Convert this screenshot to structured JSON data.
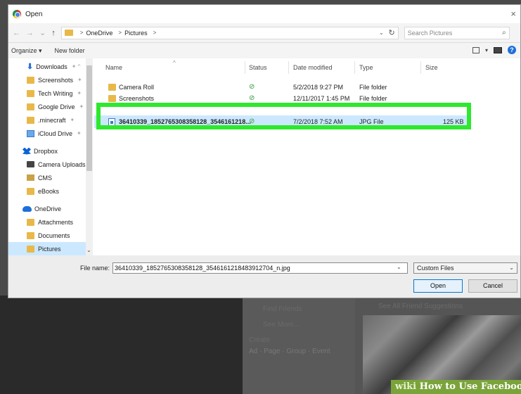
{
  "dialog": {
    "title": "Open",
    "close": "×"
  },
  "nav": {
    "back": "←",
    "forward": "→",
    "history": "⌄",
    "up": "↑",
    "crumbs": [
      "OneDrive",
      "Pictures"
    ],
    "crumb_sep": ">",
    "addr_dropdown": "⌄",
    "refresh": "↻",
    "search_placeholder": "Search Pictures",
    "search_icon": "⌕"
  },
  "toolbar": {
    "organize": "Organize ▾",
    "new_folder": "New folder",
    "help": "?",
    "view_dropdown": "▾"
  },
  "sidebar": {
    "items": [
      {
        "label": "Downloads",
        "icon": "download-icon",
        "pin": "✦ ^"
      },
      {
        "label": "Screenshots",
        "icon": "folder-icon",
        "pin": "✦"
      },
      {
        "label": "Tech Writing",
        "icon": "folder-icon",
        "pin": "✦"
      },
      {
        "label": "Google Drive",
        "icon": "folder-icon",
        "pin": "✦"
      },
      {
        "label": ".minecraft",
        "icon": "folder-icon",
        "pin": "✦"
      },
      {
        "label": "iCloud Drive",
        "icon": "icloud-icon",
        "pin": "✦"
      },
      {
        "label": "Dropbox",
        "icon": "dropbox-icon",
        "pin": ""
      },
      {
        "label": "Camera Uploads",
        "icon": "camera-icon",
        "pin": ""
      },
      {
        "label": "CMS",
        "icon": "cms-icon",
        "pin": ""
      },
      {
        "label": "eBooks",
        "icon": "folder-icon",
        "pin": ""
      },
      {
        "label": "OneDrive",
        "icon": "onedrive-icon",
        "pin": ""
      },
      {
        "label": "Attachments",
        "icon": "folder-icon",
        "pin": ""
      },
      {
        "label": "Documents",
        "icon": "folder-icon",
        "pin": ""
      },
      {
        "label": "Pictures",
        "icon": "folder-icon",
        "pin": ""
      }
    ],
    "selected": "Pictures",
    "scroll_down": "⌄"
  },
  "columns": {
    "name": "Name",
    "status": "Status",
    "date": "Date modified",
    "type": "Type",
    "size": "Size",
    "sort_caret": "^"
  },
  "files": [
    {
      "name": "Camera Roll",
      "status": "⊘",
      "date": "5/2/2018 9:27 PM",
      "type": "File folder",
      "size": "",
      "kind": "folder"
    },
    {
      "name": "Screenshots",
      "status": "⊘",
      "date": "12/11/2017 1:45 PM",
      "type": "File folder",
      "size": "",
      "kind": "folder"
    },
    {
      "name": "36410339_1852765308358128_3546161218...",
      "status": "⊘",
      "date": "7/2/2018 7:52 AM",
      "type": "JPG File",
      "size": "125 KB",
      "kind": "jpg"
    }
  ],
  "footer": {
    "file_name_label": "File name:",
    "file_name_value": "36410339_1852765308358128_3546161218483912704_n.jpg",
    "filter": "Custom Files",
    "open": "Open",
    "cancel": "Cancel",
    "dropdown": "⌄"
  },
  "background": {
    "find_friends": "Find Friends",
    "see_more": "See More...",
    "create": "Create",
    "create_links": "Ad · Page · Group · Event",
    "suggestions": "See All Friend Suggestions",
    "wiki_prefix": "wiki",
    "wiki_title": "How to Use Facebook"
  },
  "colors": {
    "highlight_box": "#2ee82e",
    "selection": "#cce8ff",
    "sync_ok": "#2e9b3a"
  }
}
